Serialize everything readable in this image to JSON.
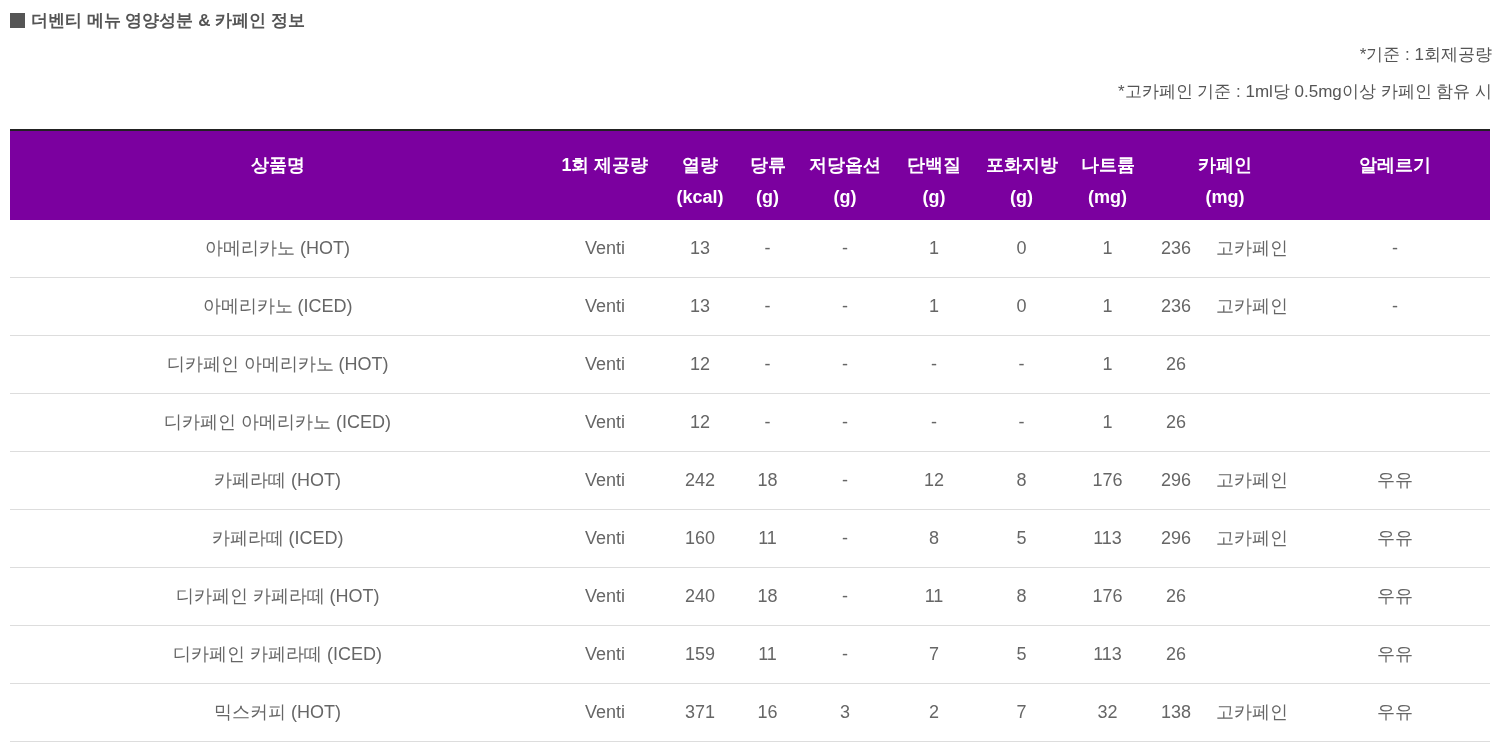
{
  "title": "더벤티 메뉴 영양성분 & 카페인 정보",
  "notes": [
    "*기준 : 1회제공량",
    "*고카페인 기준 : 1ml당 0.5mg이상 카페인 함유 시"
  ],
  "table": {
    "columns": [
      [
        "상품명"
      ],
      [
        "1회 제공량"
      ],
      [
        "열량",
        "(kcal)"
      ],
      [
        "당류",
        "(g)"
      ],
      [
        "저당옵션",
        "(g)"
      ],
      [
        "단백질",
        "(g)"
      ],
      [
        "포화지방",
        "(g)"
      ],
      [
        "나트륨",
        "(mg)"
      ],
      [
        "카페인",
        "(mg)"
      ],
      [
        "알레르기"
      ]
    ],
    "rows": [
      {
        "name": "아메리카노 (HOT)",
        "serving": "Venti",
        "kcal": "13",
        "sugar": "-",
        "low_sugar": "-",
        "protein": "1",
        "sat_fat": "0",
        "sodium": "1",
        "caffeine": "236",
        "caffeine_note": "고카페인",
        "allergy": "-"
      },
      {
        "name": "아메리카노 (ICED)",
        "serving": "Venti",
        "kcal": "13",
        "sugar": "-",
        "low_sugar": "-",
        "protein": "1",
        "sat_fat": "0",
        "sodium": "1",
        "caffeine": "236",
        "caffeine_note": "고카페인",
        "allergy": "-"
      },
      {
        "name": "디카페인 아메리카노 (HOT)",
        "serving": "Venti",
        "kcal": "12",
        "sugar": "-",
        "low_sugar": "-",
        "protein": "-",
        "sat_fat": "-",
        "sodium": "1",
        "caffeine": "26"
      },
      {
        "name": "디카페인 아메리카노 (ICED)",
        "serving": "Venti",
        "kcal": "12",
        "sugar": "-",
        "low_sugar": "-",
        "protein": "-",
        "sat_fat": "-",
        "sodium": "1",
        "caffeine": "26"
      },
      {
        "name": "카페라떼 (HOT)",
        "serving": "Venti",
        "kcal": "242",
        "sugar": "18",
        "low_sugar": "-",
        "protein": "12",
        "sat_fat": "8",
        "sodium": "176",
        "caffeine": "296",
        "caffeine_note": "고카페인",
        "allergy": "우유"
      },
      {
        "name": "카페라떼 (ICED)",
        "serving": "Venti",
        "kcal": "160",
        "sugar": "11",
        "low_sugar": "-",
        "protein": "8",
        "sat_fat": "5",
        "sodium": "113",
        "caffeine": "296",
        "caffeine_note": "고카페인",
        "allergy": "우유"
      },
      {
        "name": "디카페인 카페라떼 (HOT)",
        "serving": "Venti",
        "kcal": "240",
        "sugar": "18",
        "low_sugar": "-",
        "protein": "11",
        "sat_fat": "8",
        "sodium": "176",
        "caffeine": "26",
        "allergy": "우유"
      },
      {
        "name": "디카페인 카페라떼 (ICED)",
        "serving": "Venti",
        "kcal": "159",
        "sugar": "11",
        "low_sugar": "-",
        "protein": "7",
        "sat_fat": "5",
        "sodium": "113",
        "caffeine": "26",
        "allergy": "우유"
      },
      {
        "name": "믹스커피 (HOT)",
        "serving": "Venti",
        "kcal": "371",
        "sugar": "16",
        "low_sugar": "3",
        "protein": "2",
        "sat_fat": "7",
        "sodium": "32",
        "caffeine": "138",
        "caffeine_note": "고카페인",
        "allergy": "우유"
      }
    ]
  }
}
